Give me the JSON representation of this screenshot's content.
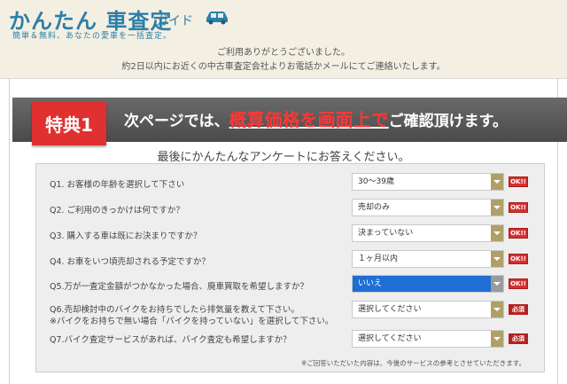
{
  "logo": {
    "main": "かんたん 車査定",
    "guide": "ガイド",
    "tagline": "簡単＆無料、あなたの愛車を一括査定。"
  },
  "thanks": {
    "line1": "ご利用ありがとうございました。",
    "line2": "約2日以内にお近くの中古車査定会社よりお電話かメールにてご連絡いたします。"
  },
  "banner": {
    "badge": "特典1",
    "text_pre": "次ページでは、",
    "text_highlight": "概算価格を画面上で",
    "text_post": "ご確認頂けます。"
  },
  "survey": {
    "title": "最後にかんたんなアンケートにお答えください。",
    "questions": [
      {
        "label": "Q1. お客様の年齢を選択して下さい",
        "value": "30～39歳",
        "tag": "OK!!"
      },
      {
        "label": "Q2. ご利用のきっかけは何ですか？",
        "value": "売却のみ",
        "tag": "OK!!"
      },
      {
        "label": "Q3. 購入する車は既にお決まりですか？",
        "value": "決まっていない",
        "tag": "OK!!"
      },
      {
        "label": "Q4. お車をいつ頃売却される予定ですか？",
        "value": "１ヶ月以内",
        "tag": "OK!!"
      },
      {
        "label": "Q5.万が一査定金額がつかなかった場合、廃車買取を希望しますか？",
        "value": "いいえ",
        "tag": "OK!!"
      },
      {
        "label": "Q6.売却検討中のバイクをお持ちでしたら排気量を教えて下さい。",
        "sublabel": "※バイクをお持ちで無い場合「バイクを持っていない」を選択して下さい。",
        "value": "選択してください",
        "tag": "必須"
      },
      {
        "label": "Q7.バイク査定サービスがあれば、バイク査定も希望しますか？",
        "value": "選択してください",
        "tag": "必須"
      }
    ],
    "note": "※ご回答いただいた内容は、今後のサービスの参考とさせていただきます。"
  },
  "colors": {
    "brand": "#2d7fa8",
    "accent_red": "#e03030",
    "banner_gray": "#555555",
    "select_arrow": "#b0a068",
    "selected_blue": "#1f6ed4"
  },
  "icons": {
    "logo_car": "car-icon",
    "dropdown": "chevron-down-icon"
  }
}
